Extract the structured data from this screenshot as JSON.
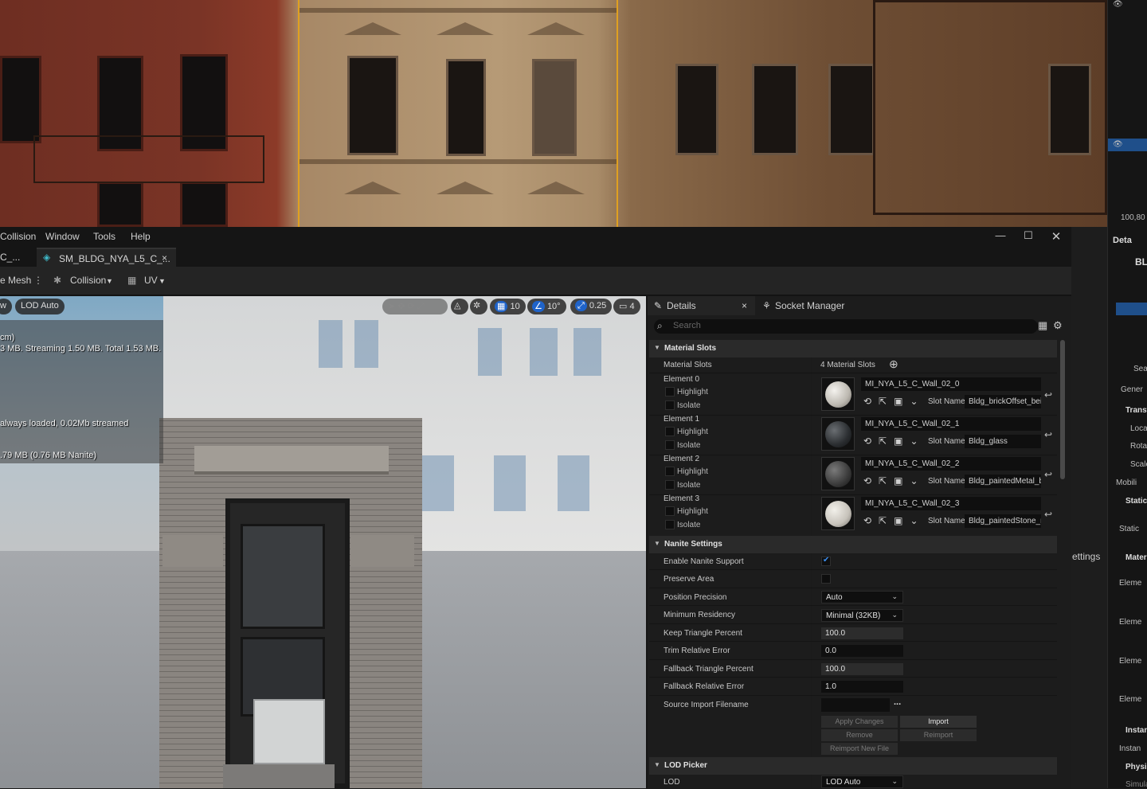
{
  "background": {
    "outliner_value": "100,80"
  },
  "right_strip": {
    "items": [
      "Deta",
      "BL",
      "Sea",
      "Gener",
      "Transf",
      "Loca",
      "Rota",
      "Scale",
      "Mobili",
      "Static",
      "Static",
      "Materi",
      "Eleme",
      "Eleme",
      "Eleme",
      "Eleme",
      "Instan",
      "Instan",
      "Physic",
      "Simula"
    ],
    "behind_text": "ettings"
  },
  "menubar": {
    "items": [
      "Collision",
      "Window",
      "Tools",
      "Help"
    ],
    "minimize": "—",
    "maximize": "☐",
    "close": "✕"
  },
  "tabs": {
    "prev_tab": "C_...",
    "active_tab": "SM_BLDG_NYA_L5_C_...",
    "close": "×"
  },
  "toolbar": {
    "mesh_label": "e Mesh",
    "collision_label": "Collision",
    "uv_label": "UV"
  },
  "viewport": {
    "lod_btn_prev": "w",
    "lod_btn": "LOD Auto",
    "grid_value": "10",
    "angle_value": "10°",
    "scale_value": "0.25",
    "camera_value": "4",
    "stats": [
      "cm)",
      "3 MB. Streaming 1.50 MB. Total 1.53 MB.",
      "always loaded, 0.02Mb streamed",
      ".79 MB (0.76 MB Nanite)"
    ]
  },
  "details": {
    "tab_details": "Details",
    "tab_close": "×",
    "tab_socket": "Socket Manager",
    "search_placeholder": "Search",
    "material_slots_section": "Material Slots",
    "material_slots_label": "Material Slots",
    "material_slots_count": "4 Material Slots",
    "highlight_label": "Highlight",
    "isolate_label": "Isolate",
    "slot_name_label": "Slot Name",
    "elements": [
      {
        "label": "Element 0",
        "material": "MI_NYA_L5_C_Wall_02_0",
        "slot": "Bldg_brickOffset_beige",
        "color": "#d8d4cc"
      },
      {
        "label": "Element 1",
        "material": "MI_NYA_L5_C_Wall_02_1",
        "slot": "Bldg_glass",
        "color": "#2a2d30"
      },
      {
        "label": "Element 2",
        "material": "MI_NYA_L5_C_Wall_02_2",
        "slot": "Bldg_paintedMetal_bla",
        "color": "#3a3a3a"
      },
      {
        "label": "Element 3",
        "material": "MI_NYA_L5_C_Wall_02_3",
        "slot": "Bldg_paintedStone_rec",
        "color": "#cfccc4"
      }
    ],
    "nanite_section": "Nanite Settings",
    "nanite": {
      "enable_label": "Enable Nanite Support",
      "preserve_label": "Preserve Area",
      "position_precision_label": "Position Precision",
      "position_precision_value": "Auto",
      "min_residency_label": "Minimum Residency",
      "min_residency_value": "Minimal (32KB)",
      "keep_triangle_label": "Keep Triangle Percent",
      "keep_triangle_value": "100.0",
      "trim_error_label": "Trim Relative Error",
      "trim_error_value": "0.0",
      "fallback_tri_label": "Fallback Triangle Percent",
      "fallback_tri_value": "100.0",
      "fallback_err_label": "Fallback Relative Error",
      "fallback_err_value": "1.0",
      "source_import_label": "Source Import Filename",
      "source_import_value": "",
      "browse": "...",
      "apply_changes": "Apply Changes",
      "import": "Import",
      "remove": "Remove",
      "reimport": "Reimport",
      "reimport_new": "Reimport New File"
    },
    "lod_section": "LOD Picker",
    "lod_label": "LOD",
    "lod_value": "LOD Auto"
  }
}
